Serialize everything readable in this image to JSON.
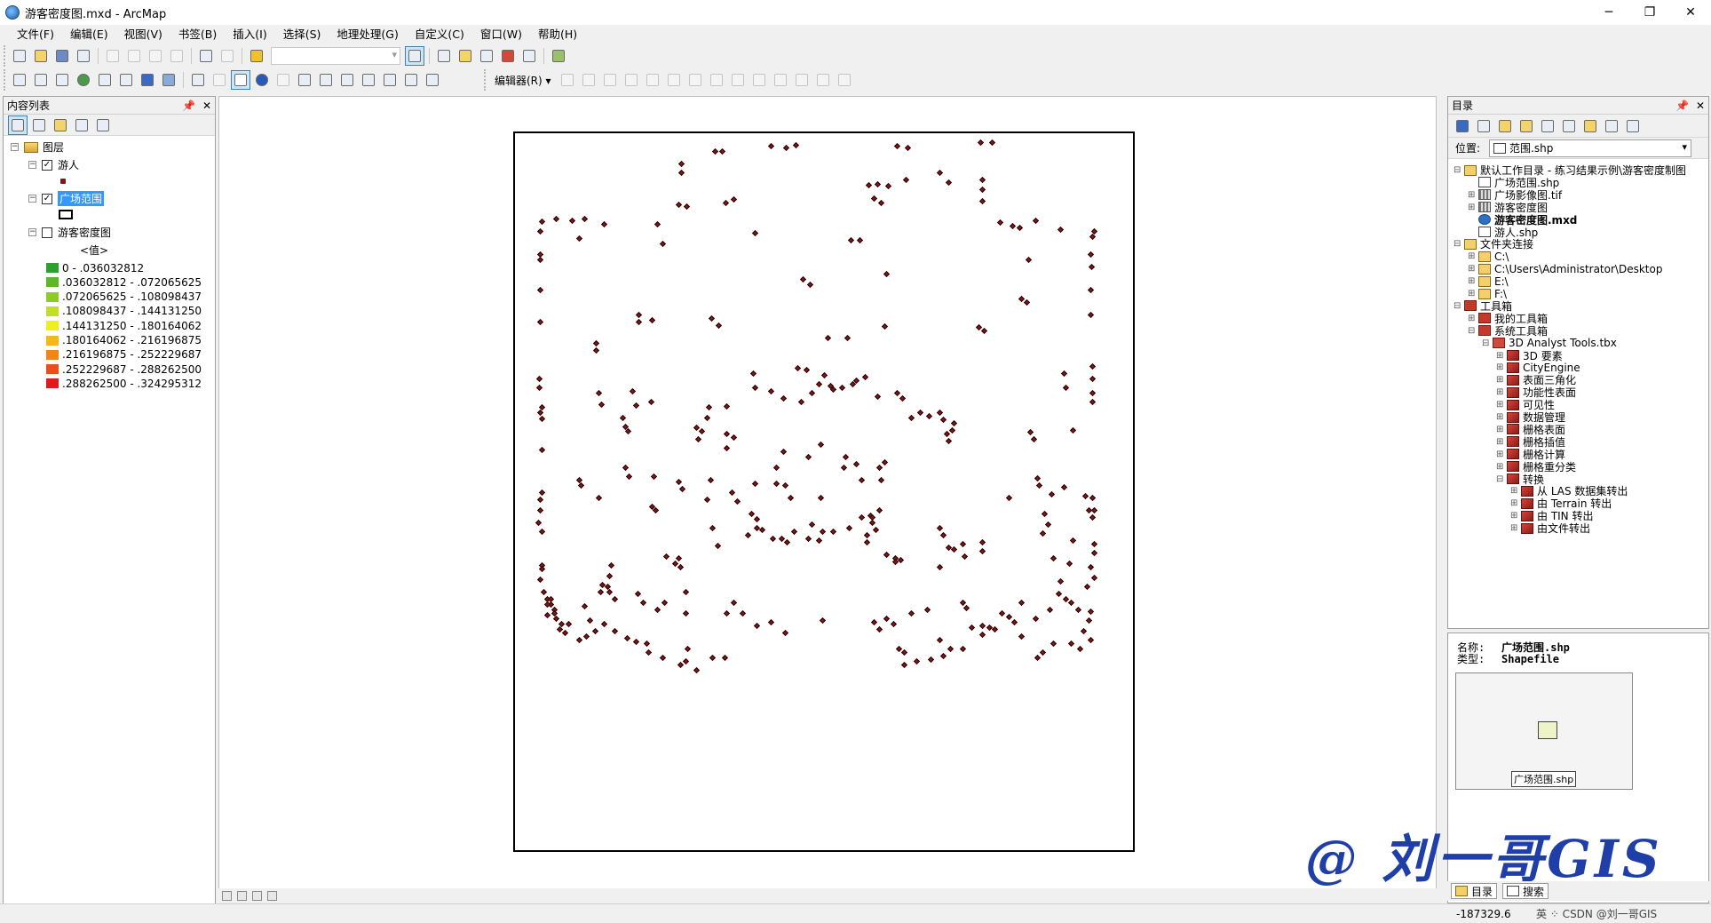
{
  "window": {
    "title": "游客密度图.mxd - ArcMap",
    "minimize": "─",
    "maximize": "❐",
    "close": "✕"
  },
  "menu": [
    "文件(F)",
    "编辑(E)",
    "视图(V)",
    "书签(B)",
    "插入(I)",
    "选择(S)",
    "地理处理(G)",
    "自定义(C)",
    "窗口(W)",
    "帮助(H)"
  ],
  "editor_toolbar": {
    "label": "编辑器(R) ▾"
  },
  "toc": {
    "title": "内容列表",
    "layers_root": "图层",
    "layers": [
      {
        "name": "游人",
        "checked": true
      },
      {
        "name": "广场范围",
        "checked": true,
        "selected": true
      },
      {
        "name": "游客密度图",
        "checked": false
      }
    ],
    "value_header": "<值>",
    "classes": [
      {
        "label": "0 - .036032812",
        "color": "#2ea02e"
      },
      {
        "label": ".036032812 - .072065625",
        "color": "#5cb82a"
      },
      {
        "label": ".072065625 - .108098437",
        "color": "#8ccc2a"
      },
      {
        "label": ".108098437 - .144131250",
        "color": "#c2de2a"
      },
      {
        "label": ".144131250 - .180164062",
        "color": "#f2ee1a"
      },
      {
        "label": ".180164062 - .216196875",
        "color": "#f5b81a"
      },
      {
        "label": ".216196875 - .252229687",
        "color": "#f0861a"
      },
      {
        "label": ".252229687 - .288262500",
        "color": "#ea4f1a"
      },
      {
        "label": ".288262500 - .324295312",
        "color": "#e01a1a"
      }
    ]
  },
  "catalog": {
    "title": "目录",
    "location_label": "位置:",
    "location_value": "范围.shp",
    "items": [
      {
        "label": "默认工作目录 - 练习结果示例\\游客密度制图",
        "icon": "folder",
        "depth": 0,
        "exp": "⊟"
      },
      {
        "label": "广场范围.shp",
        "icon": "shp-poly",
        "depth": 1,
        "exp": ""
      },
      {
        "label": "广场影像图.tif",
        "icon": "raster",
        "depth": 1,
        "exp": "⊞"
      },
      {
        "label": "游客密度图",
        "icon": "raster",
        "depth": 1,
        "exp": "⊞"
      },
      {
        "label": "游客密度图.mxd",
        "icon": "mxd",
        "depth": 1,
        "exp": "",
        "bold": true
      },
      {
        "label": "游人.shp",
        "icon": "pts",
        "depth": 1,
        "exp": ""
      },
      {
        "label": "文件夹连接",
        "icon": "folder",
        "depth": 0,
        "exp": "⊟"
      },
      {
        "label": "C:\\",
        "icon": "folder",
        "depth": 1,
        "exp": "⊞"
      },
      {
        "label": "C:\\Users\\Administrator\\Desktop",
        "icon": "folder",
        "depth": 1,
        "exp": "⊞"
      },
      {
        "label": "E:\\",
        "icon": "folder",
        "depth": 1,
        "exp": "⊞"
      },
      {
        "label": "F:\\",
        "icon": "folder",
        "depth": 1,
        "exp": "⊞"
      },
      {
        "label": "工具箱",
        "icon": "toolbox",
        "depth": 0,
        "exp": "⊟"
      },
      {
        "label": "我的工具箱",
        "icon": "toolbox",
        "depth": 1,
        "exp": "⊞"
      },
      {
        "label": "系统工具箱",
        "icon": "toolbox",
        "depth": 1,
        "exp": "⊟"
      },
      {
        "label": "3D Analyst Tools.tbx",
        "icon": "tbx",
        "depth": 2,
        "exp": "⊟"
      },
      {
        "label": "3D 要素",
        "icon": "toolset",
        "depth": 3,
        "exp": "⊞"
      },
      {
        "label": "CityEngine",
        "icon": "toolset",
        "depth": 3,
        "exp": "⊞"
      },
      {
        "label": "表面三角化",
        "icon": "toolset",
        "depth": 3,
        "exp": "⊞"
      },
      {
        "label": "功能性表面",
        "icon": "toolset",
        "depth": 3,
        "exp": "⊞"
      },
      {
        "label": "可见性",
        "icon": "toolset",
        "depth": 3,
        "exp": "⊞"
      },
      {
        "label": "数据管理",
        "icon": "toolset",
        "depth": 3,
        "exp": "⊞"
      },
      {
        "label": "栅格表面",
        "icon": "toolset",
        "depth": 3,
        "exp": "⊞"
      },
      {
        "label": "栅格插值",
        "icon": "toolset",
        "depth": 3,
        "exp": "⊞"
      },
      {
        "label": "栅格计算",
        "icon": "toolset",
        "depth": 3,
        "exp": "⊞"
      },
      {
        "label": "栅格重分类",
        "icon": "toolset",
        "depth": 3,
        "exp": "⊞"
      },
      {
        "label": "转换",
        "icon": "toolset",
        "depth": 3,
        "exp": "⊟"
      },
      {
        "label": "从 LAS 数据集转出",
        "icon": "toolset",
        "depth": 4,
        "exp": "⊞"
      },
      {
        "label": "由 Terrain 转出",
        "icon": "toolset",
        "depth": 4,
        "exp": "⊞"
      },
      {
        "label": "由 TIN 转出",
        "icon": "toolset",
        "depth": 4,
        "exp": "⊞"
      },
      {
        "label": "由文件转出",
        "icon": "toolset",
        "depth": 4,
        "exp": "⊞"
      }
    ]
  },
  "preview": {
    "name_key": "名称:",
    "name_value": "广场范围.shp",
    "type_key": "类型:",
    "type_value": "Shapefile",
    "thumb_label": "广场范围.shp"
  },
  "tabs": {
    "catalog": "目录",
    "search": "搜索"
  },
  "status": {
    "coords": "-187329.6",
    "tray": "英 ⁘ CSDN @刘一哥GIS"
  },
  "watermark": "@ 刘一哥GIS"
}
